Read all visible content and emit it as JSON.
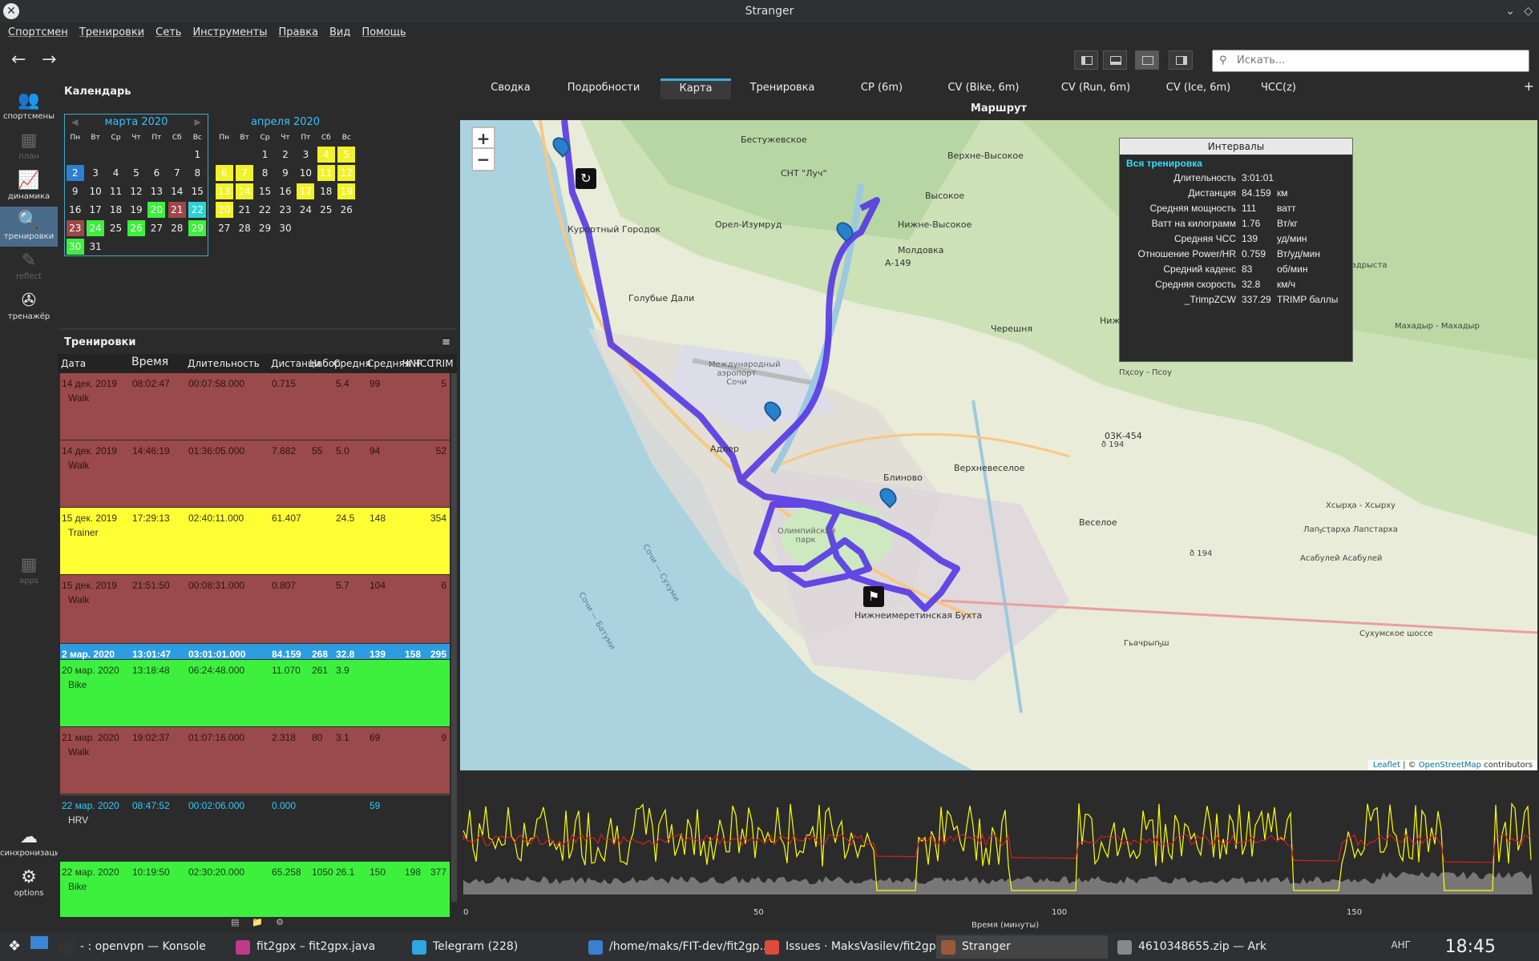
{
  "window": {
    "title": "Stranger",
    "close_glyph": "✕",
    "min_glyph": "⌄",
    "max_glyph": "◇"
  },
  "menu": [
    "Спортсмен",
    "Тренировки",
    "Сеть",
    "Инструменты",
    "Правка",
    "Вид",
    "Помощь"
  ],
  "toolbar": {
    "back": "←",
    "forward": "→",
    "search_placeholder": "Искать...",
    "search_icon": "search-icon"
  },
  "sidebar": [
    {
      "label": "спортсмены",
      "icon": "👥"
    },
    {
      "label": "план",
      "icon": "▦"
    },
    {
      "label": "динамика",
      "icon": "📈"
    },
    {
      "label": "тренировки",
      "icon": "🔍"
    },
    {
      "label": "reflect",
      "icon": "✎"
    },
    {
      "label": "тренажёр",
      "icon": "✇"
    },
    {
      "label": "apps",
      "icon": "▦"
    },
    {
      "label": "синхронизация",
      "icon": "☁"
    },
    {
      "label": "options",
      "icon": "⚙"
    }
  ],
  "calendar": {
    "title": "Календарь",
    "weekdays": [
      "Пн",
      "Вт",
      "Ср",
      "Чт",
      "Пт",
      "Сб",
      "Вс"
    ],
    "month1": {
      "title": "марта 2020",
      "prev": "◀",
      "next": "▶"
    },
    "month2": {
      "title": "апреля 2020"
    }
  },
  "workouts": {
    "title": "Тренировки",
    "menu_glyph": "≡",
    "columns": [
      "Дата",
      "Время",
      "Длительность",
      "Дистанци",
      "Набор",
      "Средня",
      "Средняя ЧСС",
      "ЧNP",
      "TRIM"
    ],
    "rows": [
      {
        "date": "14 дек. 2019",
        "time": "08:02:47",
        "dur": "00:07:58.000",
        "dist": "0.715",
        "climb": "",
        "speed": "5.4",
        "hr": "99",
        "np": "",
        "trimp": "5",
        "sport": "Walk",
        "style": "walk"
      },
      {
        "date": "14 дек. 2019",
        "time": "14:46:19",
        "dur": "01:36:05.000",
        "dist": "7.682",
        "climb": "55",
        "speed": "5.0",
        "hr": "94",
        "np": "",
        "trimp": "52",
        "sport": "Walk",
        "style": "walk"
      },
      {
        "date": "15 дек. 2019",
        "time": "17:29:13",
        "dur": "02:40:11.000",
        "dist": "61.407",
        "climb": "",
        "speed": "24.5",
        "hr": "148",
        "np": "",
        "trimp": "354",
        "sport": "Trainer",
        "style": "yellow"
      },
      {
        "date": "15 дек. 2019",
        "time": "21:51:50",
        "dur": "00:08:31.000",
        "dist": "0.807",
        "climb": "",
        "speed": "5.7",
        "hr": "104",
        "np": "",
        "trimp": "6",
        "sport": "Walk",
        "style": "walk"
      },
      {
        "date": "2 мар. 2020",
        "time": "13:01:47",
        "dur": "03:01:01.000",
        "dist": "84.159",
        "climb": "268",
        "speed": "32.8",
        "hr": "139",
        "np": "158",
        "trimp": "295",
        "sport": "",
        "style": "blue"
      },
      {
        "date": "20 мар. 2020",
        "time": "13:18:48",
        "dur": "06:24:48.000",
        "dist": "11.070",
        "climb": "261",
        "speed": "3.9",
        "hr": "",
        "np": "",
        "trimp": "",
        "sport": "Bike",
        "style": "green"
      },
      {
        "date": "21 мар. 2020",
        "time": "19:02:37",
        "dur": "01:07:16.000",
        "dist": "2.318",
        "climb": "80",
        "speed": "3.1",
        "hr": "69",
        "np": "",
        "trimp": "9",
        "sport": "Walk",
        "style": "walk"
      },
      {
        "date": "22 мар. 2020",
        "time": "08:47:52",
        "dur": "00:02:06.000",
        "dist": "0.000",
        "climb": "",
        "speed": "",
        "hr": "59",
        "np": "",
        "trimp": "",
        "sport": "HRV",
        "style": "hrv"
      },
      {
        "date": "22 мар. 2020",
        "time": "10:19:50",
        "dur": "02:30:20.000",
        "dist": "65.258",
        "climb": "1050",
        "speed": "26.1",
        "hr": "150",
        "np": "198",
        "trimp": "377",
        "sport": "Bike",
        "style": "green"
      }
    ],
    "footer_icons": [
      "▤",
      "📁",
      "⚙"
    ]
  },
  "tabs": [
    "Сводка",
    "Подробности",
    "Карта",
    "Тренировка",
    "CP (6m)",
    "CV (Bike, 6m)",
    "CV (Run, 6m)",
    "CV (Ice, 6m)",
    "ЧСС(z)"
  ],
  "active_tab": "Карта",
  "tab_plus": "+",
  "map": {
    "title": "Маршрут",
    "zoom_in": "+",
    "zoom_out": "−",
    "attribution_link1": "Leaflet",
    "attribution_sep": " | © ",
    "attribution_link2": "OpenStreetMap",
    "attribution_tail": " contributors",
    "places": [
      "Бестужевское",
      "Верхне-Высокое",
      "СНТ \"Луч\"",
      "Высокое",
      "Орел-Изумруд",
      "Нижне-Высокое",
      "Молдовка",
      "Курортный Городок",
      "Голубые Дали",
      "А-149",
      "Нижняя Шиловка",
      "Черешня",
      "Международный аэропорт Сочи",
      "Адлер",
      "Блиново",
      "Верхневеселое",
      "03К-454",
      "Веселое",
      "Олимпийский парк",
      "Нижнеимеретинская Бухта",
      "Пҳсоу - Псоу",
      "Аҳадрыҳста Мпадрыста",
      "Махадыр - Махадыр",
      "Хсырҳа - Хсырху",
      "Лаҧсҭарҳа Лапстарха",
      "Асабулей Асабулей",
      "Гьачрыҧш",
      "Сочи — Сухуми",
      "Сочи — Батуми",
      "ð 194",
      "ð 194",
      "Сухумское шоссе"
    ]
  },
  "intervals": {
    "title": "Интервалы",
    "section": "Вся тренировка",
    "rows": [
      {
        "label": "Длительность",
        "value": "3:01:01",
        "unit": ""
      },
      {
        "label": "Дистанция",
        "value": "84.159",
        "unit": "км"
      },
      {
        "label": "Средняя мощность",
        "value": "111",
        "unit": "ватт"
      },
      {
        "label": "Ватт на килограмм",
        "value": "1.76",
        "unit": "Вт/кг"
      },
      {
        "label": "Средняя ЧСС",
        "value": "139",
        "unit": "уд/мин"
      },
      {
        "label": "Отношение Power/HR",
        "value": "0.759",
        "unit": "Вт/уд/мин"
      },
      {
        "label": "Средний каденс",
        "value": "83",
        "unit": "об/мин"
      },
      {
        "label": "Средняя скорость",
        "value": "32.8",
        "unit": "км/ч"
      },
      {
        "label": "_TrimpZCW",
        "value": "337.29",
        "unit": "TRIMP баллы"
      }
    ]
  },
  "chart": {
    "xlabel": "Время (минуты)",
    "ticks": [
      "0",
      "50",
      "100",
      "150"
    ],
    "colors": {
      "power": "#ffff00",
      "hr": "#d02020",
      "alt": "#777777"
    }
  },
  "taskbar": {
    "items": [
      {
        "label": "- : openvpn — Konsole",
        "color": "#333"
      },
      {
        "label": "fit2gpx – fit2gpx.java",
        "color": "#c03a8a"
      },
      {
        "label": "Telegram (228)",
        "color": "#2ea6e0"
      },
      {
        "label": "/home/maks/FIT-dev/fit2gp...",
        "color": "#3a7fd0"
      },
      {
        "label": "Issues · MaksVasilev/fit2gpx...",
        "color": "#dd4b39"
      },
      {
        "label": "Stranger",
        "color": "#9a5a3a"
      },
      {
        "label": "4610348655.zip — Ark",
        "color": "#888"
      }
    ],
    "tray": "АНГ",
    "clock": "18:45"
  }
}
